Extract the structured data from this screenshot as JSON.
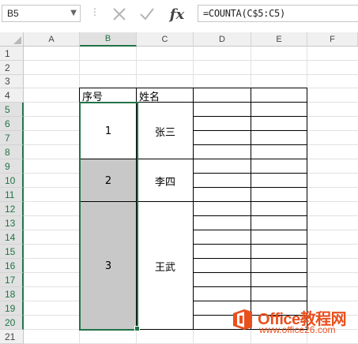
{
  "formula_bar": {
    "name_box": "B5",
    "name_dropdown_icon": "chevron-down-icon",
    "cancel_icon": "close-icon",
    "enter_icon": "check-icon",
    "fx_label": "fx",
    "formula": "=COUNTA(C$5:C5)"
  },
  "columns": [
    "A",
    "B",
    "C",
    "D",
    "E",
    "F"
  ],
  "selected_column": "B",
  "rows": [
    "1",
    "2",
    "3",
    "4",
    "5",
    "6",
    "7",
    "8",
    "9",
    "10",
    "11",
    "12",
    "13",
    "14",
    "15",
    "16",
    "17",
    "18",
    "19",
    "20",
    "21"
  ],
  "selected_rows": [
    "5",
    "6",
    "7",
    "8",
    "9",
    "10",
    "11",
    "12",
    "13",
    "14",
    "15",
    "16",
    "17",
    "18",
    "19",
    "20"
  ],
  "table": {
    "header_seq": "序号",
    "header_name": "姓名",
    "groups": [
      {
        "seq": "1",
        "name": "张三",
        "filled": false
      },
      {
        "seq": "2",
        "name": "李四",
        "filled": true
      },
      {
        "seq": "3",
        "name": "王武",
        "filled": true
      }
    ]
  },
  "colors": {
    "accent": "#217346",
    "selected_fill": "#c8c8c8",
    "watermark": "#e8501e"
  },
  "watermark": {
    "line1": "Office教程网",
    "line2": "www.office26.com"
  }
}
